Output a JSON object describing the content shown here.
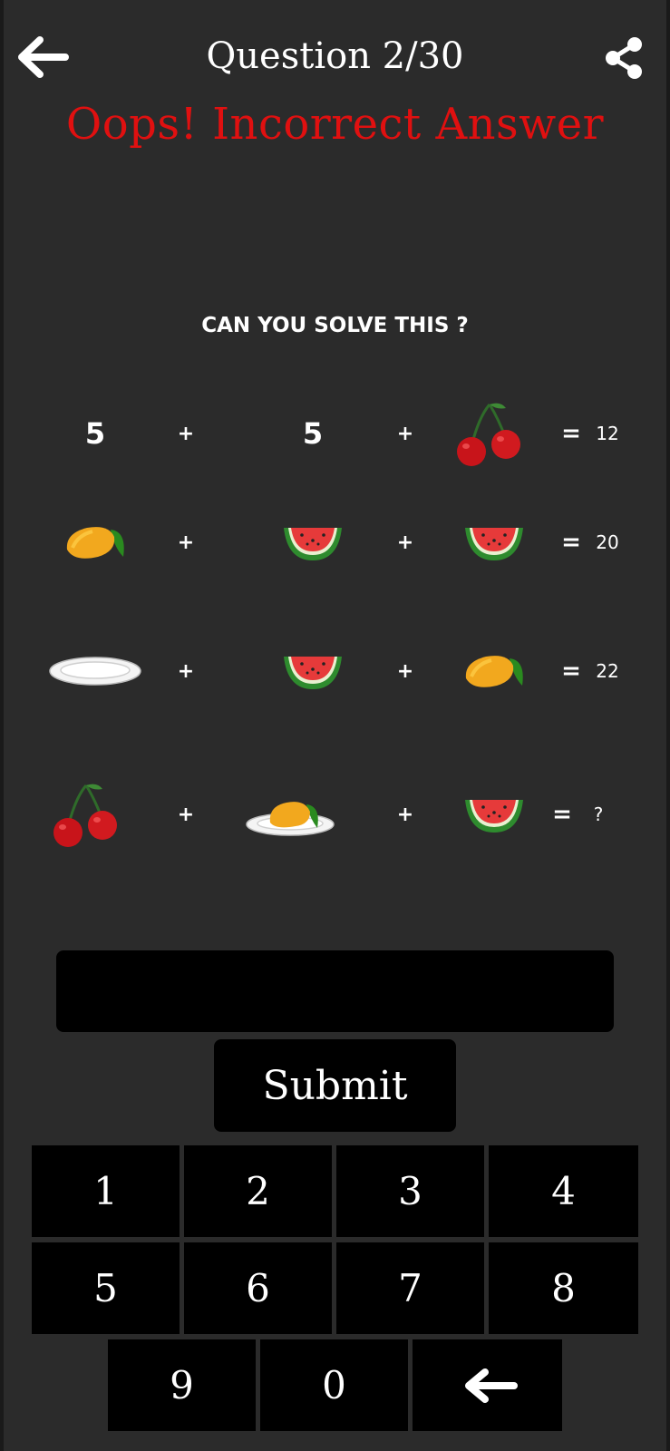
{
  "header": {
    "title": "Question 2/30",
    "back_icon": "arrow-left-icon",
    "share_icon": "share-icon"
  },
  "status": {
    "message": "Oops! Incorrect Answer",
    "color": "#e01010"
  },
  "puzzle": {
    "prompt": "CAN YOU SOLVE THIS ?",
    "operator": "+",
    "equals": "=",
    "rows": [
      {
        "terms": [
          "5",
          "5",
          "cherries-icon"
        ],
        "result": "12"
      },
      {
        "terms": [
          "mango-icon",
          "watermelon-slice-icon",
          "watermelon-slice-icon"
        ],
        "result": "20"
      },
      {
        "terms": [
          "plate-icon",
          "watermelon-slice-icon",
          "mango-icon"
        ],
        "result": "22"
      },
      {
        "terms": [
          "cherries-icon",
          "mango-on-plate-icon",
          "watermelon-slice-icon"
        ],
        "result": "?"
      }
    ]
  },
  "answer": {
    "value": ""
  },
  "submit": {
    "label": "Submit"
  },
  "keypad": {
    "row1": [
      "1",
      "2",
      "3",
      "4"
    ],
    "row2": [
      "5",
      "6",
      "7",
      "8"
    ],
    "row3": [
      "9",
      "0"
    ],
    "backspace_icon": "backspace-arrow-icon"
  }
}
